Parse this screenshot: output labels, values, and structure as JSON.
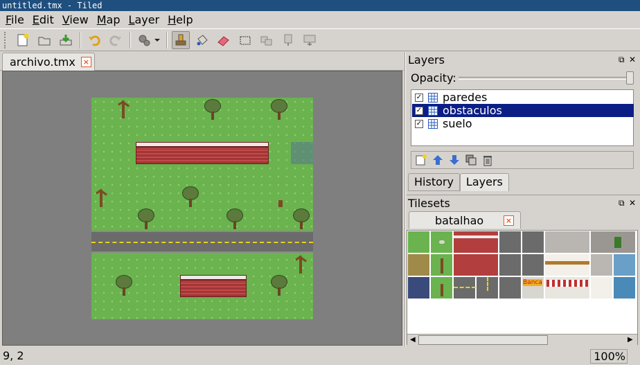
{
  "window": {
    "title": "untitled.tmx - Tiled"
  },
  "menu": [
    {
      "label": "File",
      "mnemonic": "F",
      "rest": "ile"
    },
    {
      "label": "Edit",
      "mnemonic": "E",
      "rest": "dit"
    },
    {
      "label": "View",
      "mnemonic": "V",
      "rest": "iew"
    },
    {
      "label": "Map",
      "mnemonic": "M",
      "rest": "ap"
    },
    {
      "label": "Layer",
      "mnemonic": "L",
      "rest": "ayer"
    },
    {
      "label": "Help",
      "mnemonic": "H",
      "rest": "elp"
    }
  ],
  "document_tab": {
    "label": "archivo.tmx",
    "close": "×"
  },
  "layers_panel": {
    "title": "Layers",
    "float": "⧉",
    "close": "✕",
    "opacity_label": "Opacity:",
    "opacity": 1.0,
    "layers": [
      {
        "name": "paredes",
        "checked": "✓",
        "selected": false
      },
      {
        "name": "obstaculos",
        "checked": "✓",
        "selected": true
      },
      {
        "name": "suelo",
        "checked": "✓",
        "selected": false
      }
    ],
    "tabs": [
      "History",
      "Layers"
    ],
    "active_tab": "Layers"
  },
  "tilesets_panel": {
    "title": "Tilesets",
    "float": "⧉",
    "close": "✕",
    "tab": "batalhao",
    "tab_close": "×",
    "sign_text": "Banca"
  },
  "status": {
    "coords": "9, 2",
    "zoom": "100%"
  },
  "colors": {
    "titlebar": "#1e4f7e",
    "selection": "#0b1e86",
    "grass": "#6ab34f",
    "road": "#6b6b6b",
    "brick": "#b33e3e"
  }
}
